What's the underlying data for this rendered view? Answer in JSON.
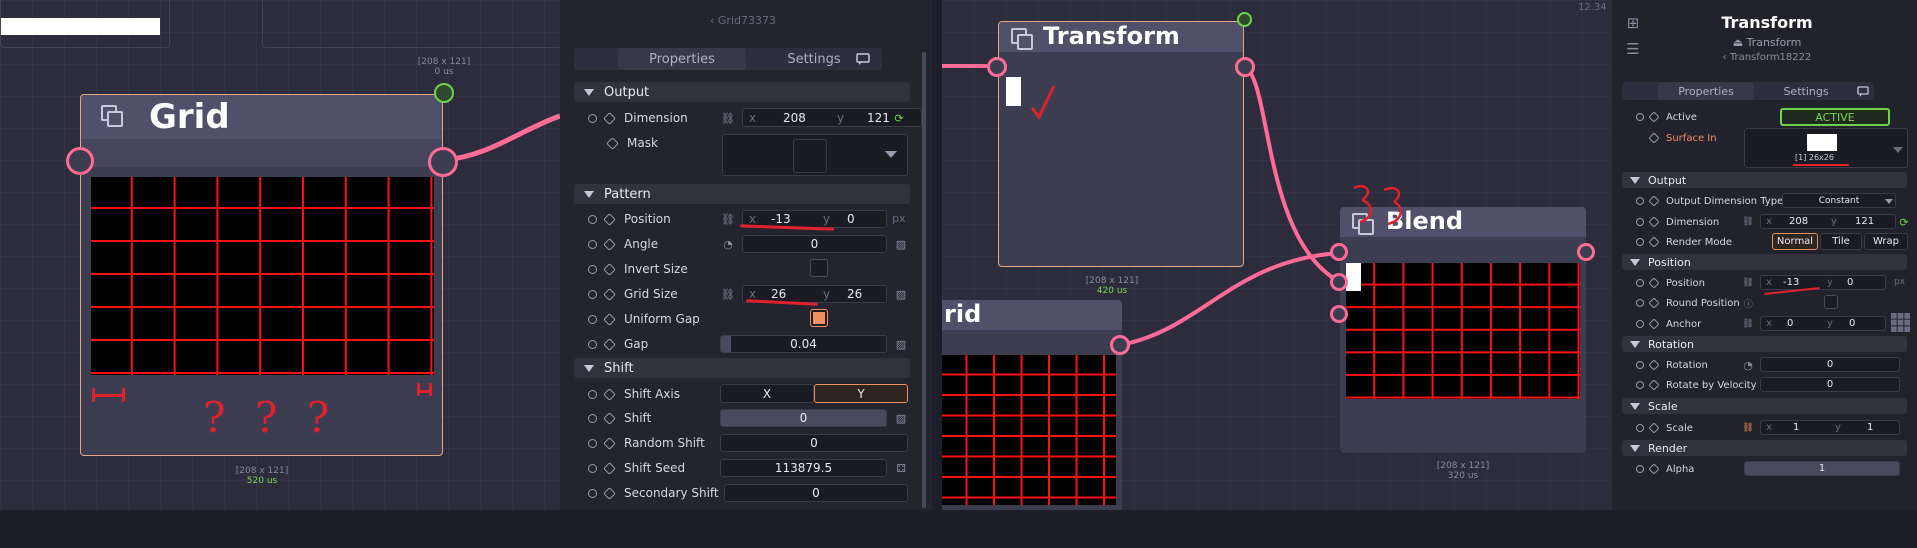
{
  "left": {
    "breadcrumb": "Grid73373",
    "grid_node": {
      "title": "Grid",
      "size_top": "[208 x 121]",
      "time_top": "0 us",
      "size_bottom": "[208 x 121]",
      "time_bottom": "520 us",
      "annotation": "? ? ?"
    },
    "inspector": {
      "tabs": [
        "Properties",
        "Settings"
      ],
      "sections": {
        "output": "Output",
        "pattern": "Pattern",
        "shift": "Shift"
      },
      "rows": {
        "dimension": {
          "label": "Dimension",
          "x": "208",
          "y": "121"
        },
        "mask": {
          "label": "Mask"
        },
        "position": {
          "label": "Position",
          "x": "-13",
          "y": "0",
          "unit": "px"
        },
        "angle": {
          "label": "Angle",
          "value": "0"
        },
        "invert_size": {
          "label": "Invert Size",
          "checked": false
        },
        "grid_size": {
          "label": "Grid Size",
          "x": "26",
          "y": "26"
        },
        "uniform_gap": {
          "label": "Uniform Gap",
          "checked": true
        },
        "gap": {
          "label": "Gap",
          "value": "0.04",
          "fill": 0.04
        },
        "shift_axis": {
          "label": "Shift Axis",
          "options": [
            "X",
            "Y"
          ],
          "selected": "Y"
        },
        "shift": {
          "label": "Shift",
          "value": "0"
        },
        "random_shift": {
          "label": "Random Shift",
          "value": "0"
        },
        "shift_seed": {
          "label": "Shift Seed",
          "value": "113879.5"
        },
        "secondary_shift": {
          "label": "Secondary Shift",
          "value": "0"
        }
      }
    }
  },
  "right": {
    "time_corner": "12.34",
    "transform_node": {
      "title": "Transform",
      "size": "[208 x 121]",
      "time": "420 us"
    },
    "grid_node_title": "rid",
    "blend_node": {
      "title": "Blend",
      "size": "[208 x 121]",
      "time": "320 us"
    },
    "inspector": {
      "title": "Transform",
      "subtitle": "Transform",
      "crumb": "Transform18222",
      "tabs": [
        "Properties",
        "Settings"
      ],
      "active": {
        "label": "Active",
        "value": "ACTIVE"
      },
      "surface_in": {
        "label": "Surface In",
        "info": "[1] 26x26"
      },
      "sections": {
        "output": "Output",
        "position": "Position",
        "rotation": "Rotation",
        "scale": "Scale",
        "render": "Render"
      },
      "rows": {
        "output_dim_type": {
          "label": "Output Dimension Type",
          "value": "Constant"
        },
        "dimension": {
          "label": "Dimension",
          "x": "208",
          "y": "121"
        },
        "render_mode": {
          "label": "Render Mode",
          "options": [
            "Normal",
            "Tile",
            "Wrap"
          ],
          "selected": "Normal"
        },
        "position": {
          "label": "Position",
          "x": "-13",
          "y": "0",
          "unit": "px"
        },
        "round_position": {
          "label": "Round Position"
        },
        "anchor": {
          "label": "Anchor",
          "x": "0",
          "y": "0"
        },
        "rotation": {
          "label": "Rotation",
          "value": "0"
        },
        "rotate_by_velocity": {
          "label": "Rotate by Velocity",
          "value": "0"
        },
        "scale": {
          "label": "Scale",
          "x": "1",
          "y": "1"
        },
        "alpha": {
          "label": "Alpha",
          "value": "1"
        }
      }
    }
  },
  "colors": {
    "wire": "#ff6b97",
    "accent": "#f08f5f",
    "active_green": "#6fd34a",
    "grid_line": "#ff1010",
    "annotation": "#e0202a"
  }
}
